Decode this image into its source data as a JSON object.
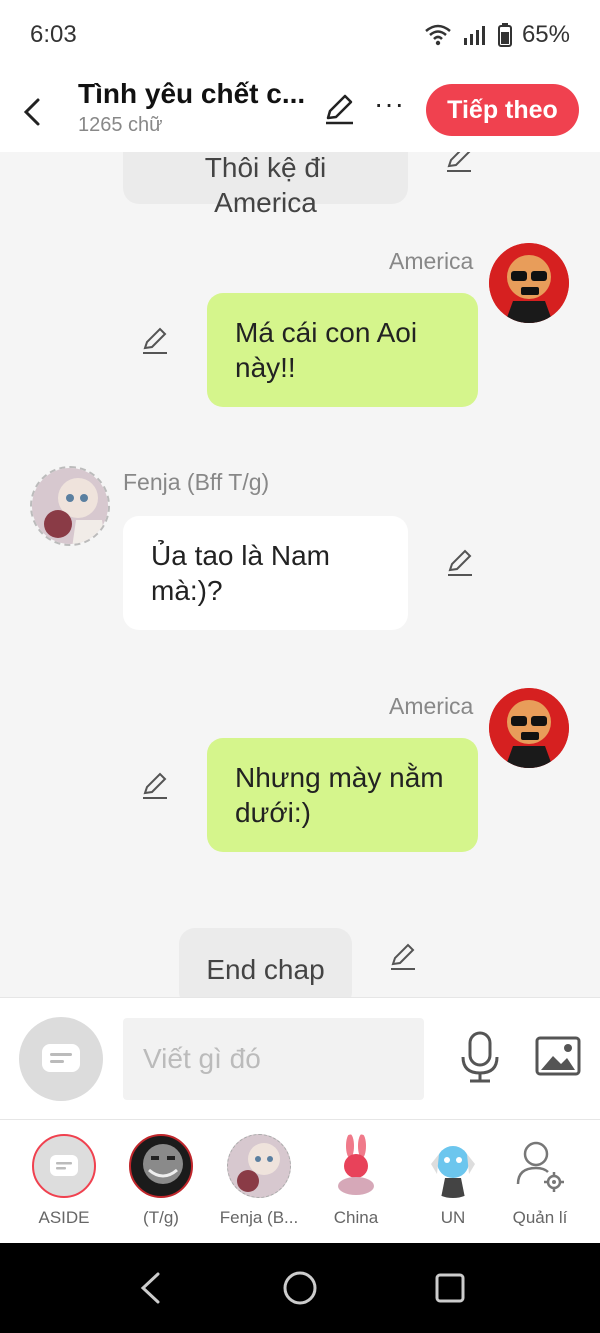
{
  "status": {
    "time": "6:03",
    "battery": "65%"
  },
  "header": {
    "title": "Tình yêu chết c...",
    "subtitle": "1265 chữ",
    "next_label": "Tiếp theo"
  },
  "messages": [
    {
      "type": "narration",
      "text": "Thôi kệ đi America"
    },
    {
      "type": "right",
      "name": "America",
      "text": "Má cái con Aoi này!!"
    },
    {
      "type": "left",
      "name": "Fenja (Bff T/g)",
      "text": "Ủa tao là Nam mà:)?"
    },
    {
      "type": "right",
      "name": "America",
      "text": "Nhưng mày nằm dưới:)"
    },
    {
      "type": "narration",
      "text": "End chap"
    }
  ],
  "composer": {
    "placeholder": "Viết gì đó"
  },
  "characters": [
    {
      "label": "ASIDE"
    },
    {
      "label": "(T/g)"
    },
    {
      "label": "Fenja (B..."
    },
    {
      "label": "China"
    },
    {
      "label": "UN"
    },
    {
      "label": "Quản lí"
    }
  ],
  "colors": {
    "accent": "#f0414f",
    "green_bubble": "#d5f58c",
    "grey_bubble": "#ebebeb"
  }
}
